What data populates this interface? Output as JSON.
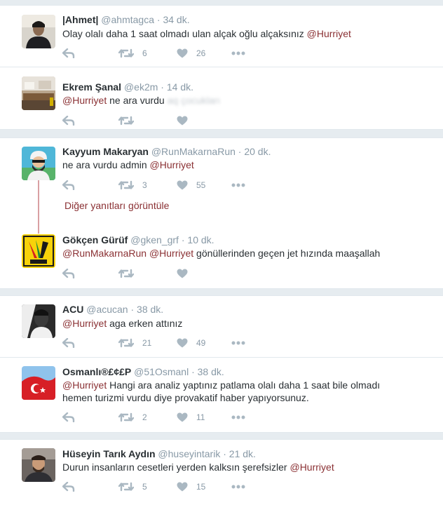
{
  "tweets": [
    {
      "name": "|Ahmet|",
      "handle": "@ahmtagca",
      "time": "34 dk.",
      "text_pre": "Olay olalı daha 1 saat olmadı ulan alçak oğlu alçaksınız",
      "mention": "@Hurriyet",
      "retweets": "6",
      "likes": "26"
    },
    {
      "name": "Ekrem Şanal",
      "handle": "@ek2m",
      "time": "14 dk.",
      "mention": "@Hurriyet",
      "text_post": "ne ara vurdu",
      "blurred": "aq çocukları"
    },
    {
      "name": "Kayyum Makaryan",
      "handle": "@RunMakarnaRun",
      "time": "20 dk.",
      "text_pre": "ne ara vurdu admin",
      "mention": "@Hurriyet",
      "retweets": "3",
      "likes": "55"
    },
    {
      "name": "Gökçen Gürüf",
      "handle": "@gken_grf",
      "time": "10 dk.",
      "mention1": "@RunMakarnaRun",
      "mention2": "@Hurriyet",
      "text_post": "gönüllerinden geçen jet hızında maaşallah"
    },
    {
      "name": "ACU",
      "handle": "@acucan",
      "time": "38 dk.",
      "mention": "@Hurriyet",
      "text_post": "aga erken attınız",
      "retweets": "21",
      "likes": "49"
    },
    {
      "name": "Osmanlı®£¢£P",
      "handle": "@51Osmanl",
      "time": "38 dk.",
      "mention": "@Hurriyet",
      "text_line1": "Hangi ara analiz yaptınız patlama olalı daha 1 saat bile olmadı",
      "text_line2": "hemen  turizmi vurdu diye provakatif haber yapıyorsunuz.",
      "retweets": "2",
      "likes": "11"
    },
    {
      "name": "Hüseyin Tarık Aydın",
      "handle": "@huseyintarik",
      "time": "21 dk.",
      "text_pre": "Durun insanların cesetleri yerden kalksın şerefsizler",
      "mention": "@Hurriyet",
      "retweets": "5",
      "likes": "15"
    }
  ],
  "thread": {
    "more_replies": "Diğer yanıtları görüntüle"
  },
  "separator": "·",
  "icons": {
    "reply": "reply-icon",
    "retweet": "retweet-icon",
    "like": "heart-icon",
    "more": "more-dots-icon"
  },
  "colors": {
    "name": "#292f33",
    "meta": "#8899a6",
    "link": "#8a3033",
    "action": "#aab8c2",
    "background": "#e6ecf0",
    "thread_line": "#d9a0a3"
  }
}
